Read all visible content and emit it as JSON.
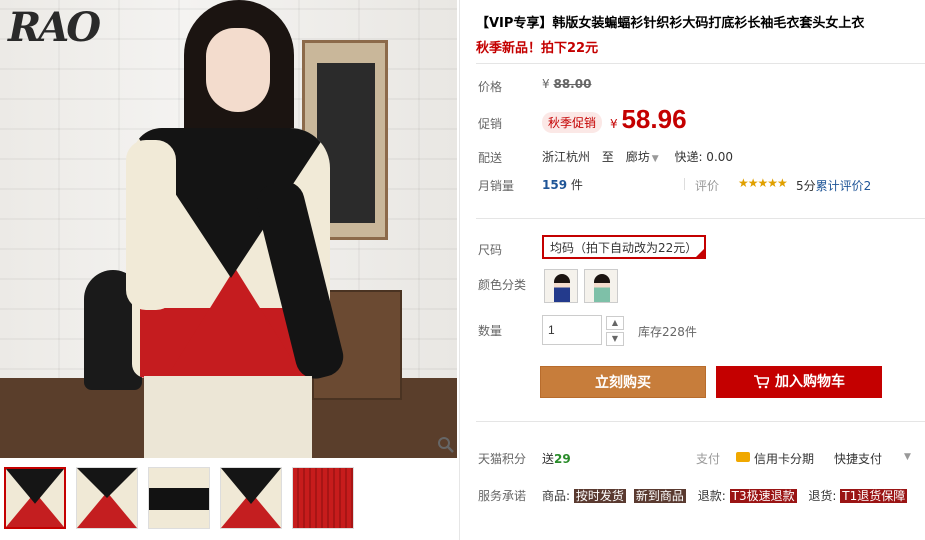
{
  "gallery": {
    "logo": "RAO",
    "zoom_icon": "magnifier-icon"
  },
  "product": {
    "title": "【VIP专享】韩版女装蝙蝠衫针织衫大码打底衫长袖毛衣套头女上衣",
    "subtitle": "秋季新品！拍下22元"
  },
  "price": {
    "label": "价格",
    "currency": "¥",
    "original": "88.00"
  },
  "promo": {
    "label": "促销",
    "tag": "秋季促销",
    "currency": "¥",
    "value": "58.96"
  },
  "shipping": {
    "label": "配送",
    "from": "浙江杭州",
    "to_word": "至",
    "destination": "廊坊",
    "fee": "快递: 0.00"
  },
  "sales": {
    "label": "月销量",
    "count": "159",
    "unit": "件",
    "rating_label": "评价",
    "stars": "★★★★★",
    "score": "5分",
    "review_link": "累计评价2"
  },
  "options": {
    "size_label": "尺码",
    "size_value": "均码（拍下自动改为22元）",
    "color_label": "颜色分类",
    "qty_label": "数量",
    "qty_value": "1",
    "stock": "库存228件"
  },
  "actions": {
    "buy": "立刻购买",
    "cart": "加入购物车"
  },
  "service": {
    "points_label": "天猫积分",
    "points_prefix": "送",
    "points_value": "29",
    "pay_label": "支付",
    "card_installment": "信用卡分期",
    "quick_pay": "快捷支付",
    "promise_label": "服务承诺",
    "goods_label": "商品:",
    "goods_tag1": "按时发货",
    "goods_tag2": "新到商品",
    "refund_label": "退款:",
    "refund_tag": "T3极速退款",
    "return_label": "退货:",
    "return_tag": "T1退货保障"
  },
  "colors": {
    "accent": "#c40000",
    "buy_button": "#c77d3b",
    "cart_button": "#c40000",
    "sales_count": "#1f5597",
    "points": "#2a8c2a"
  }
}
